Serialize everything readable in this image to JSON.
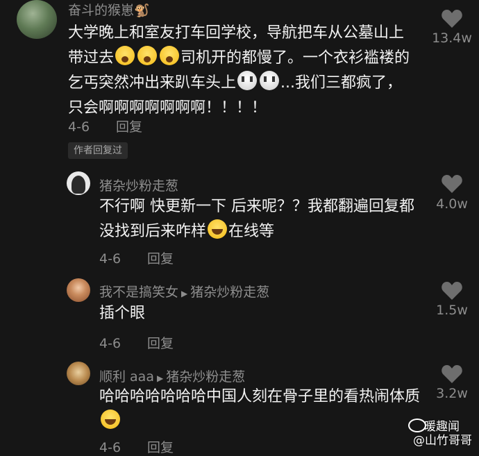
{
  "comments": [
    {
      "username": "奋斗的猴崽",
      "username_emoji": "🐒",
      "text_parts": [
        "大学晚上和室友打车回学校，导航把车从公墓山上带过去",
        "司机开的都慢了。一个衣衫褴褛的乞丐突然冲出来趴车头上",
        "...我们三都疯了，只会啊啊啊啊啊啊啊！！！！"
      ],
      "date": "4-6",
      "reply_label": "回复",
      "badge": "作者回复过",
      "likes": "13.4w"
    },
    {
      "username": "猪杂炒粉走葱",
      "text_parts": [
        "不行啊 快更新一下 后来呢？？我都翻遍回复都没找到后来咋样",
        "在线等"
      ],
      "date": "4-6",
      "reply_label": "回复",
      "likes": "4.0w"
    },
    {
      "username": "我不是搞笑女",
      "reply_to": "猪杂炒粉走葱",
      "text": "插个眼",
      "date": "4-6",
      "reply_label": "回复",
      "likes": "1.5w"
    },
    {
      "username": "顺利 aaa",
      "reply_to": "猪杂炒粉走葱",
      "text_parts": [
        "哈哈哈哈哈哈哈中国人刻在骨子里的看热闹体质"
      ],
      "date": "4-6",
      "reply_label": "回复",
      "likes": "3.2w"
    }
  ],
  "watermark": {
    "line1": "暖趣闻",
    "line2": "@山竹哥哥"
  },
  "colors": {
    "background": "#161616",
    "text": "#f2f2f2",
    "meta": "#8d8d8d"
  }
}
